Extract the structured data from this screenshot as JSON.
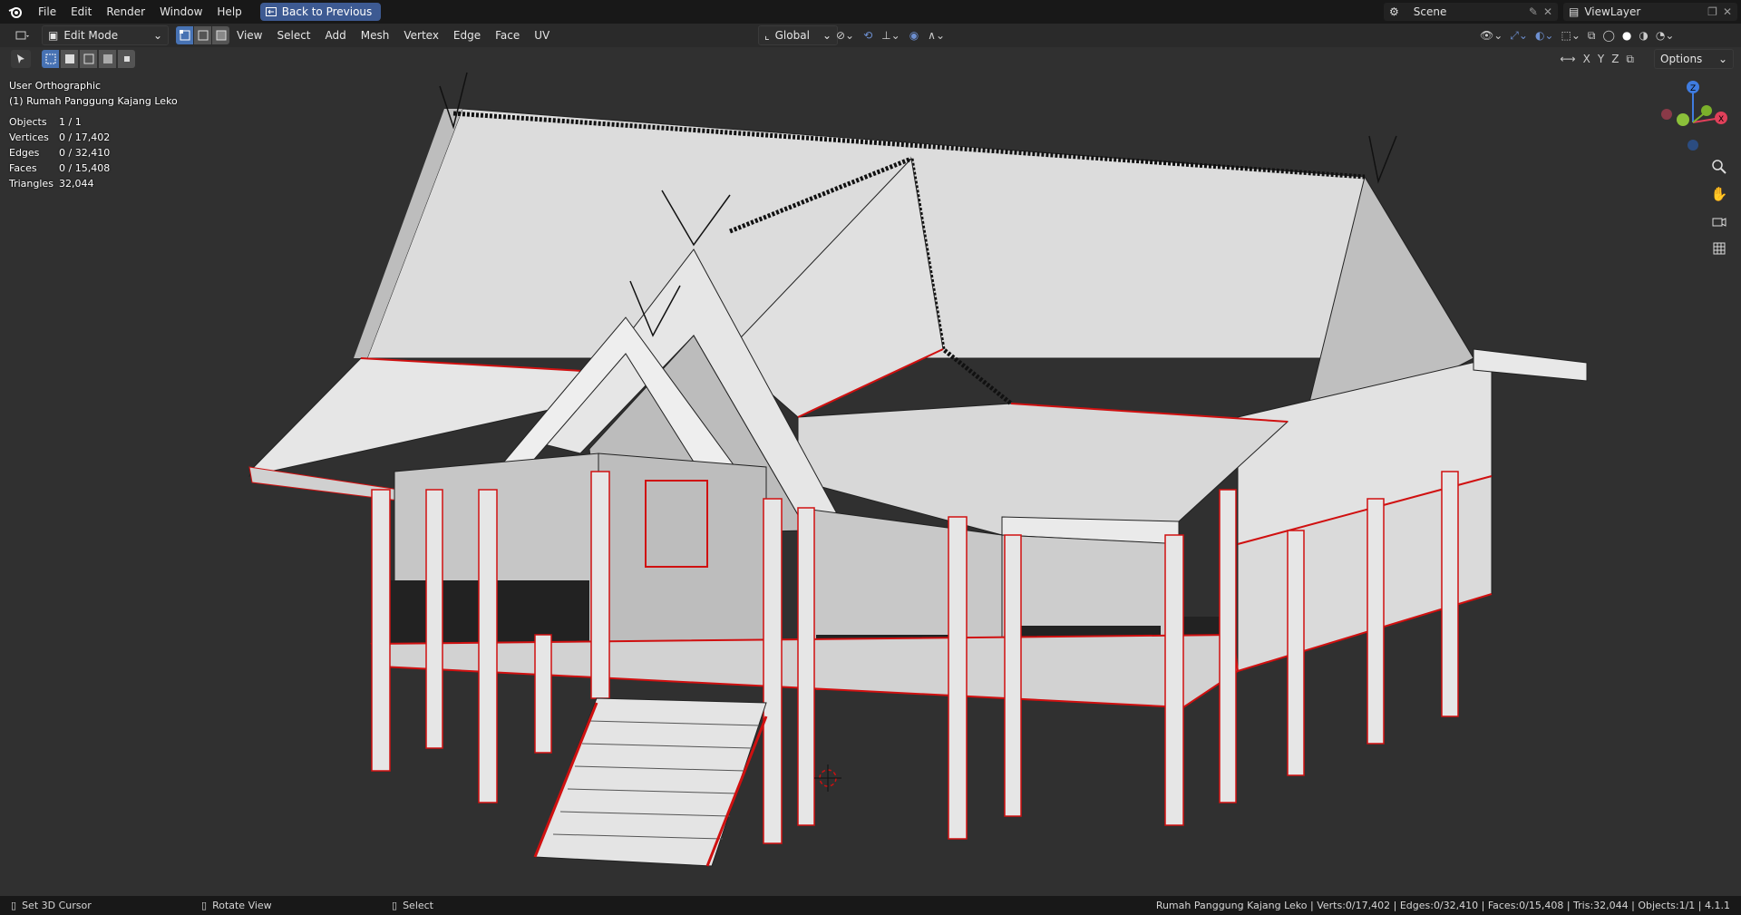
{
  "topbar": {
    "menus": [
      "File",
      "Edit",
      "Render",
      "Window",
      "Help"
    ],
    "back_label": "Back to Previous",
    "scene_name": "Scene",
    "view_layer": "ViewLayer"
  },
  "header": {
    "mode": "Edit Mode",
    "view_menus": [
      "View",
      "Select",
      "Add",
      "Mesh",
      "Vertex",
      "Edge",
      "Face",
      "UV"
    ],
    "orientation": "Global",
    "options_label": "Options",
    "axis_labels": [
      "X",
      "Y",
      "Z"
    ]
  },
  "overlay": {
    "view_name": "User Orthographic",
    "object_name": "(1) Rumah Panggung Kajang Leko",
    "stats": [
      {
        "label": "Objects",
        "value": "1 / 1"
      },
      {
        "label": "Vertices",
        "value": "0 / 17,402"
      },
      {
        "label": "Edges",
        "value": "0 / 32,410"
      },
      {
        "label": "Faces",
        "value": "0 / 15,408"
      },
      {
        "label": "Triangles",
        "value": "32,044"
      }
    ]
  },
  "statusbar": {
    "hint_left": "Set 3D Cursor",
    "hint_middle": "Rotate View",
    "hint_right": "Select",
    "summary": "Rumah Panggung Kajang Leko | Verts:0/17,402 | Edges:0/32,410 | Faces:0/15,408 | Tris:32,044 | Objects:1/1 | 4.1.1"
  },
  "colors": {
    "accent": "#4772b3",
    "seam_edge": "#d01010",
    "background": "#303030"
  }
}
